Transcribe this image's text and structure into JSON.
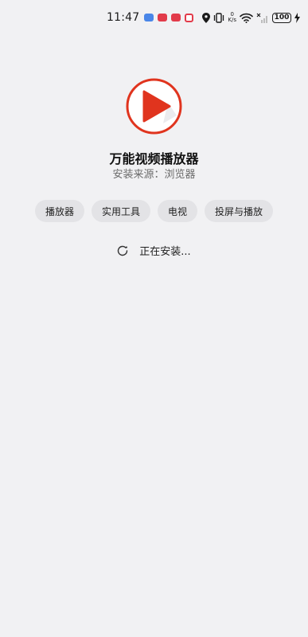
{
  "status_bar": {
    "time": "11:47",
    "network_speed_value": "0",
    "network_speed_unit": "K/s",
    "battery": "100"
  },
  "app": {
    "name": "万能视频播放器",
    "source": "安装来源：浏览器",
    "icon": "play-icon",
    "brand_color": "#e0341e"
  },
  "tags": [
    "播放器",
    "实用工具",
    "电视",
    "投屏与播放"
  ],
  "install": {
    "status": "正在安装..."
  }
}
